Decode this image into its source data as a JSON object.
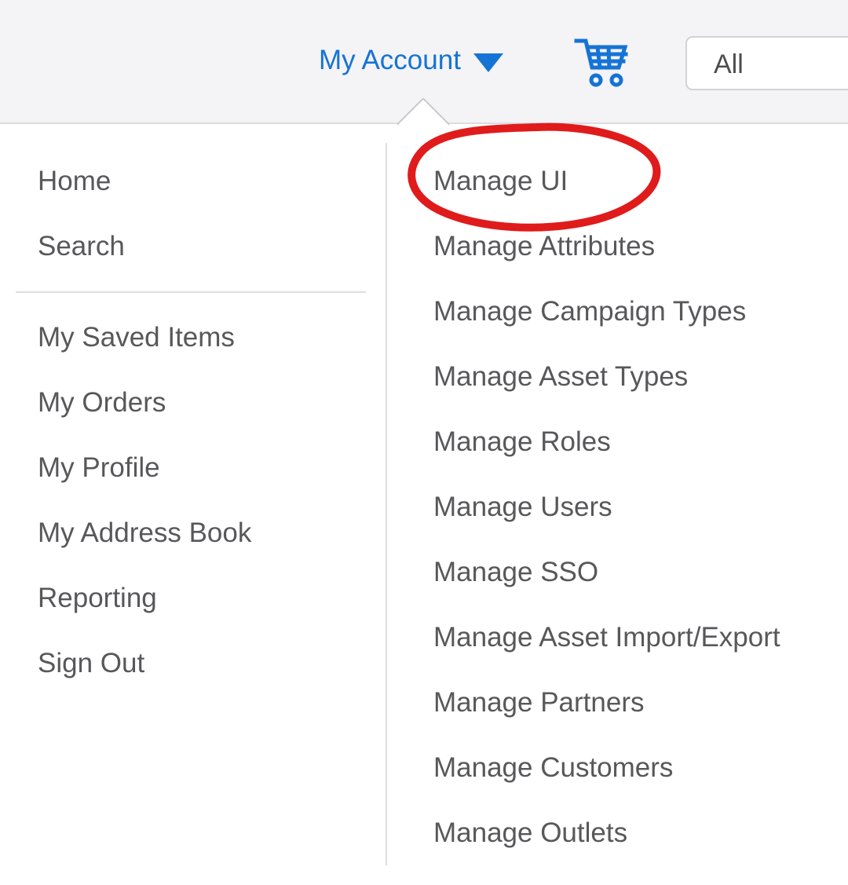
{
  "header": {
    "account_menu": {
      "label": "My Account",
      "caret_icon": "chevron-down-icon"
    },
    "cart_icon": "shopping-cart-icon",
    "search_scope": {
      "value": "All",
      "placeholder": "All"
    },
    "background_color": "#f4f4f6",
    "link_color": "#1673d6"
  },
  "dropdown": {
    "left_column": {
      "items": [
        {
          "label": "Home"
        },
        {
          "label": "Search"
        },
        {
          "label": "My Saved Items"
        },
        {
          "label": "My Orders"
        },
        {
          "label": "My Profile"
        },
        {
          "label": "My Address Book"
        },
        {
          "label": "Reporting"
        },
        {
          "label": "Sign Out"
        }
      ]
    },
    "right_column": {
      "items": [
        {
          "label": "Manage UI"
        },
        {
          "label": "Manage Attributes"
        },
        {
          "label": "Manage Campaign Types"
        },
        {
          "label": "Manage Asset Types"
        },
        {
          "label": "Manage Roles"
        },
        {
          "label": "Manage Users"
        },
        {
          "label": "Manage SSO"
        },
        {
          "label": "Manage Asset Import/Export"
        },
        {
          "label": "Manage Partners"
        },
        {
          "label": "Manage Customers"
        },
        {
          "label": "Manage Outlets"
        }
      ]
    },
    "text_color": "#58585b"
  },
  "annotation": {
    "shape": "ellipse",
    "target_label": "Manage UI",
    "color": "#e01b1b",
    "stroke_width": 10
  }
}
